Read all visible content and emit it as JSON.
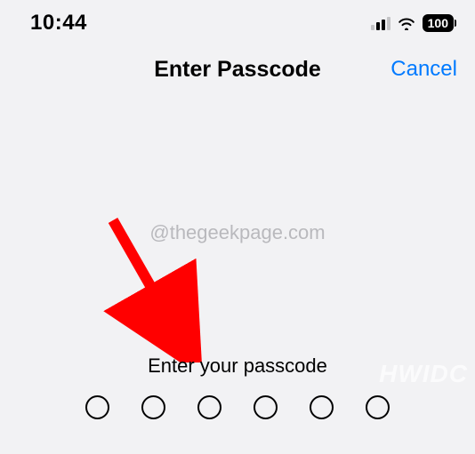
{
  "status_bar": {
    "time": "10:44",
    "battery": "100"
  },
  "nav": {
    "title": "Enter Passcode",
    "cancel": "Cancel"
  },
  "watermark": {
    "center": "@thegeekpage.com",
    "corner": "HWIDC"
  },
  "prompt": "Enter your passcode",
  "passcode_length": 6
}
